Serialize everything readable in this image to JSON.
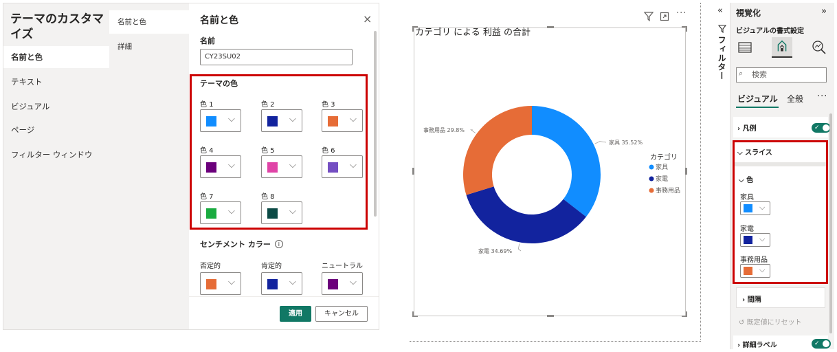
{
  "dialog": {
    "title": "テーマのカスタマイズ",
    "nav": [
      "名前と色",
      "テキスト",
      "ビジュアル",
      "ページ",
      "フィルター ウィンドウ"
    ],
    "subnav": [
      "名前と色",
      "詳細"
    ],
    "section_title": "名前と色",
    "close_glyph": "×",
    "name_label": "名前",
    "name_value": "CY23SU02",
    "theme_colors_label": "テーマの色",
    "theme_colors": [
      {
        "label": "色 1",
        "color": "#118DFF"
      },
      {
        "label": "色 2",
        "color": "#12239E"
      },
      {
        "label": "色 3",
        "color": "#E66C37"
      },
      {
        "label": "色 4",
        "color": "#6B007B"
      },
      {
        "label": "色 5",
        "color": "#E044A7"
      },
      {
        "label": "色 6",
        "color": "#744EC2"
      },
      {
        "label": "色 7",
        "color": "#1AAB40"
      },
      {
        "label": "色 8",
        "color": "#0B4A45"
      }
    ],
    "sentiment_label": "センチメント カラー",
    "sentiment_colors": [
      {
        "label": "否定的",
        "color": "#E66C37"
      },
      {
        "label": "肯定的",
        "color": "#12239E"
      },
      {
        "label": "ニュートラル",
        "color": "#6B007B"
      }
    ],
    "apply_label": "適用",
    "cancel_label": "キャンセル"
  },
  "chart_data": {
    "type": "pie",
    "variant": "donut",
    "title": "カテゴリ による 利益 の合計",
    "legend_title": "カテゴリ",
    "legend_position": "right",
    "categories": [
      "家具",
      "家電",
      "事務用品"
    ],
    "values": [
      35.52,
      34.69,
      29.8
    ],
    "data_labels": [
      "家具 35.52%",
      "家電 34.69%",
      "事務用品 29.8%"
    ],
    "colors": [
      "#118DFF",
      "#12239E",
      "#E66C37"
    ]
  },
  "canvas": {
    "filter_icon": "filter-icon",
    "focus_icon": "focus-mode-icon",
    "more_icon": "more-options-icon"
  },
  "filters_pane": {
    "label": "フィルター",
    "collapse_glyph": "«"
  },
  "viz_pane": {
    "title": "視覚化",
    "expand_glyph": "»",
    "subtitle": "ビジュアルの書式設定",
    "search_placeholder": "検索",
    "tabs": [
      "ビジュアル",
      "全般"
    ],
    "more_glyph": "···",
    "legend_label": "凡例",
    "slices_label": "スライス",
    "color_label": "色",
    "slice_colors": [
      {
        "label": "家具",
        "color": "#118DFF"
      },
      {
        "label": "家電",
        "color": "#12239E"
      },
      {
        "label": "事務用品",
        "color": "#E66C37"
      }
    ],
    "spacing_label": "間隔",
    "reset_label": "既定値にリセット",
    "detail_labels_label": "詳細ラベル"
  }
}
